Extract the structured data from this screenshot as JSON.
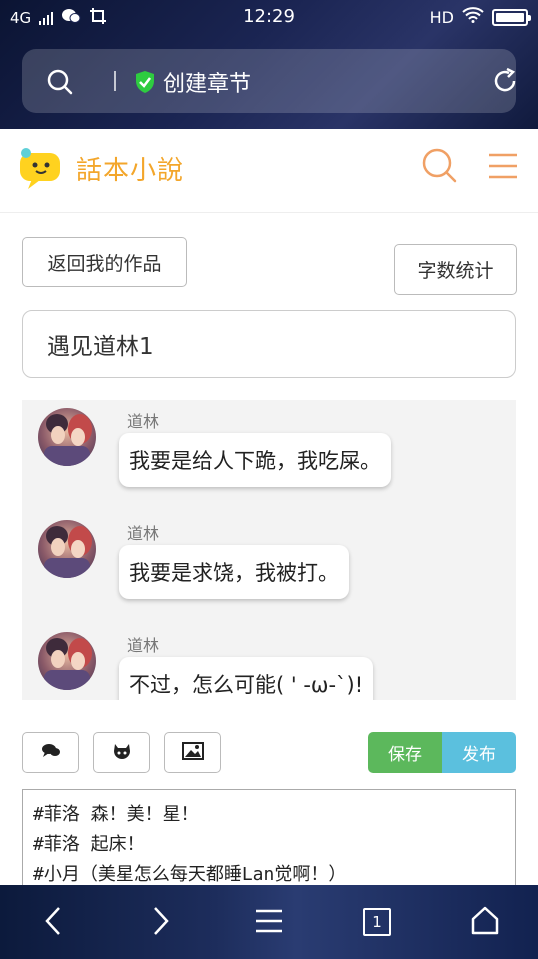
{
  "status_bar": {
    "network": "4G",
    "time": "12:29",
    "hd": "HD"
  },
  "browser": {
    "address_title": "创建章节",
    "tab_count": "1"
  },
  "site": {
    "logo_text": "話本小說"
  },
  "buttons": {
    "back": "返回我的作品",
    "word_count": "字数统计",
    "save": "保存",
    "publish": "发布"
  },
  "chapter_title": "遇见道林1",
  "preview": {
    "messages": [
      {
        "name": "道林",
        "text": "我要是给人下跪，我吃屎。"
      },
      {
        "name": "道林",
        "text": "我要是求饶，我被打。"
      },
      {
        "name": "道林",
        "text": "不过，怎么可能( ' -ω-`)!"
      }
    ]
  },
  "editor": {
    "lines": [
      "#菲洛 森！美！星！",
      "#菲洛 起床！",
      "#小月（美星怎么每天都睡Lan觉啊！）"
    ]
  },
  "icons": {
    "brand_orange": "#f0a065",
    "save_green": "#5cb85c",
    "publish_blue": "#5bc0de"
  }
}
